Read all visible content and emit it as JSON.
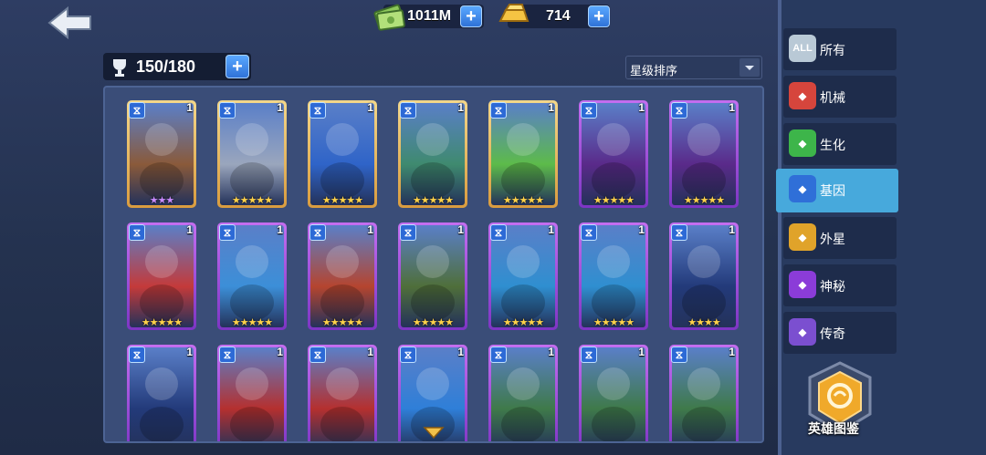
{
  "topbar": {
    "cash": "1011M",
    "gold": "714"
  },
  "roster": {
    "capacity": "150/180"
  },
  "sort": {
    "label": "星级排序"
  },
  "tabs": [
    {
      "key": "all",
      "label": "所有",
      "icon": "all-icon",
      "icon_text": "ALL",
      "color": "#b9c9d6"
    },
    {
      "key": "mech",
      "label": "机械",
      "icon": "mech-icon",
      "color": "#d6453c"
    },
    {
      "key": "bio",
      "label": "生化",
      "icon": "bio-icon",
      "color": "#3db54a"
    },
    {
      "key": "gene",
      "label": "基因",
      "icon": "gene-icon",
      "color": "#2f6fd8"
    },
    {
      "key": "alien",
      "label": "外星",
      "icon": "alien-icon",
      "color": "#e0a32a"
    },
    {
      "key": "mystic",
      "label": "神秘",
      "icon": "mystic-icon",
      "color": "#8b3cd8"
    },
    {
      "key": "legend",
      "label": "传奇",
      "icon": "legend-icon",
      "color": "#7b4fd0"
    }
  ],
  "active_tab": "gene",
  "codex": {
    "label": "英雄图鉴"
  },
  "heroes": [
    {
      "level": "1",
      "stars": "★★★",
      "star_color": "#c98bff",
      "frame": "gold",
      "portrait": "#8a5a3a"
    },
    {
      "level": "1",
      "stars": "★★★★★",
      "star_color": "#ffd24a",
      "frame": "gold",
      "portrait": "#9aa6bd"
    },
    {
      "level": "1",
      "stars": "★★★★★",
      "star_color": "#ffd24a",
      "frame": "gold",
      "portrait": "#2f64c8"
    },
    {
      "level": "1",
      "stars": "★★★★★",
      "star_color": "#ffd24a",
      "frame": "gold",
      "portrait": "#3f8a6f"
    },
    {
      "level": "1",
      "stars": "★★★★★",
      "star_color": "#ffd24a",
      "frame": "gold",
      "portrait": "#5dbb4a"
    },
    {
      "level": "1",
      "stars": "★★★★★",
      "star_color": "#ffd24a",
      "frame": "purple",
      "portrait": "#5a2a8a"
    },
    {
      "level": "1",
      "stars": "★★★★★",
      "star_color": "#ffd24a",
      "frame": "purple",
      "portrait": "#5a2a8a"
    },
    {
      "level": "1",
      "stars": "★★★★★",
      "star_color": "#ffd24a",
      "frame": "purple",
      "portrait": "#c43a3a"
    },
    {
      "level": "1",
      "stars": "★★★★★",
      "star_color": "#ffd24a",
      "frame": "purple",
      "portrait": "#3c8fd8"
    },
    {
      "level": "1",
      "stars": "★★★★★",
      "star_color": "#ffd24a",
      "frame": "purple",
      "portrait": "#b5452f"
    },
    {
      "level": "1",
      "stars": "★★★★★",
      "star_color": "#ffd24a",
      "frame": "purple",
      "portrait": "#4f6f3a"
    },
    {
      "level": "1",
      "stars": "★★★★★",
      "star_color": "#ffd24a",
      "frame": "purple",
      "portrait": "#2f8fd0"
    },
    {
      "level": "1",
      "stars": "★★★★★",
      "star_color": "#ffd24a",
      "frame": "purple",
      "portrait": "#2f8fd0"
    },
    {
      "level": "1",
      "stars": "★★★★",
      "star_color": "#ffd24a",
      "frame": "purple",
      "portrait": "#233a7a"
    },
    {
      "level": "1",
      "stars": "",
      "star_color": "#ffd24a",
      "frame": "purple",
      "portrait": "#233a7a"
    },
    {
      "level": "1",
      "stars": "",
      "star_color": "#ffd24a",
      "frame": "purple",
      "portrait": "#b5302f"
    },
    {
      "level": "1",
      "stars": "",
      "star_color": "#ffd24a",
      "frame": "purple",
      "portrait": "#b5302f"
    },
    {
      "level": "1",
      "stars": "",
      "star_color": "#ffd24a",
      "frame": "purple",
      "portrait": "#2f7fd8"
    },
    {
      "level": "1",
      "stars": "",
      "star_color": "#ffd24a",
      "frame": "purple",
      "portrait": "#3f7a4a"
    },
    {
      "level": "1",
      "stars": "",
      "star_color": "#ffd24a",
      "frame": "purple",
      "portrait": "#3f7a4a"
    },
    {
      "level": "1",
      "stars": "",
      "star_color": "#ffd24a",
      "frame": "purple",
      "portrait": "#3f7a4a"
    }
  ]
}
